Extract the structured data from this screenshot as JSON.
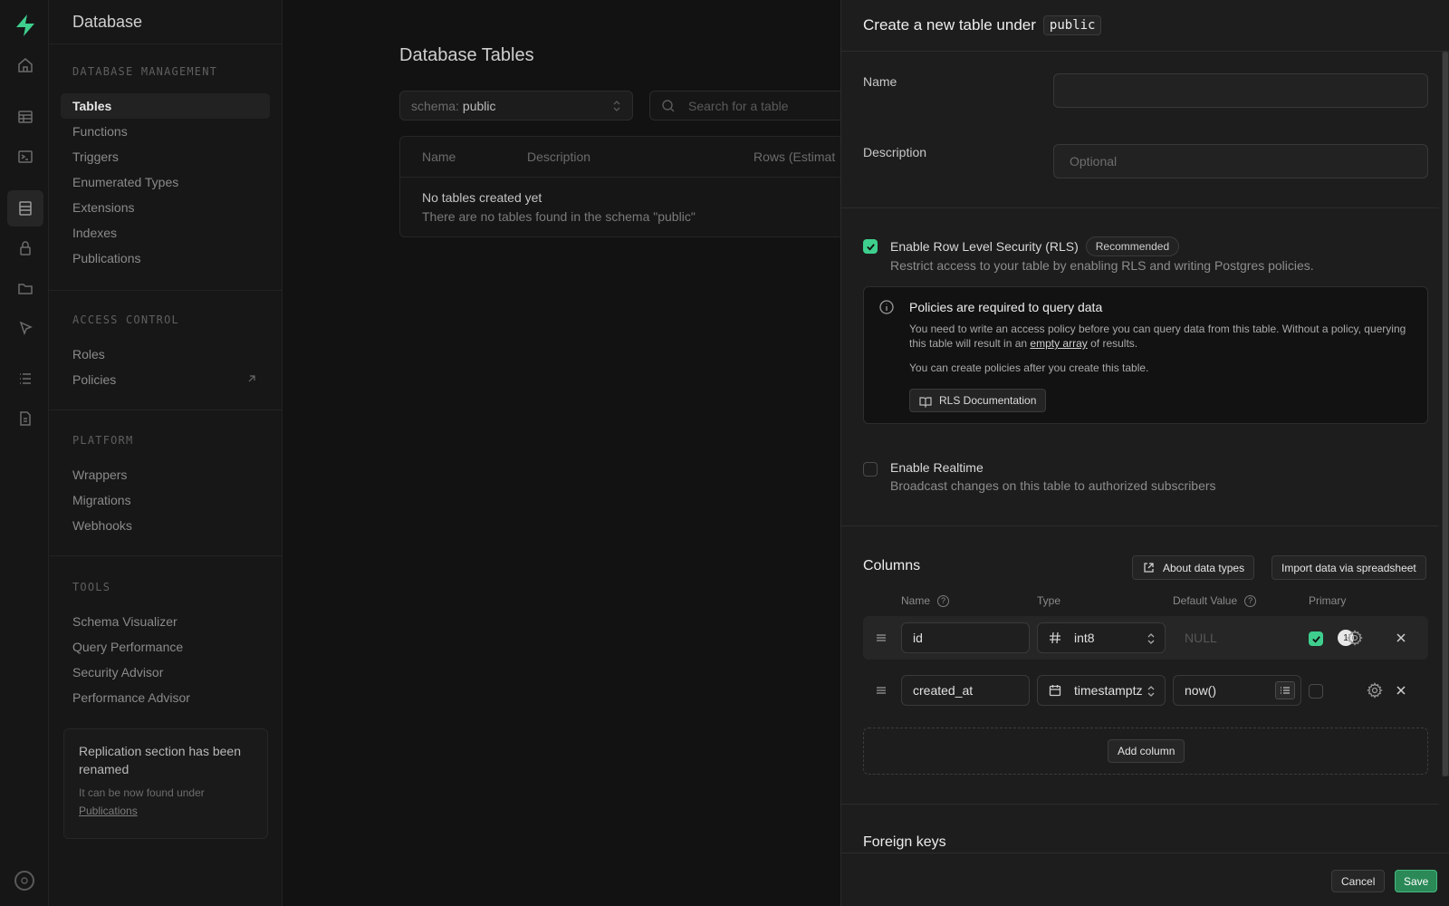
{
  "colors": {
    "accent": "#3ecf8e",
    "save_button": "#2a8957",
    "panel_bg": "#1d1d1d"
  },
  "rail": {
    "logo": "supabase-logo",
    "icons": [
      "home-icon",
      "table-editor-icon",
      "sql-editor-icon",
      "database-icon",
      "auth-lock-icon",
      "storage-icon",
      "edge-functions-icon",
      "logs-icon",
      "reports-icon"
    ],
    "active": "database-icon"
  },
  "sidebar": {
    "title": "Database",
    "sections": [
      {
        "title": "DATABASE MANAGEMENT",
        "items": [
          "Tables",
          "Functions",
          "Triggers",
          "Enumerated Types",
          "Extensions",
          "Indexes",
          "Publications"
        ]
      },
      {
        "title": "ACCESS CONTROL",
        "items": [
          "Roles",
          "Policies"
        ]
      },
      {
        "title": "PLATFORM",
        "items": [
          "Wrappers",
          "Migrations",
          "Webhooks"
        ]
      },
      {
        "title": "TOOLS",
        "items": [
          "Schema Visualizer",
          "Query Performance",
          "Security Advisor",
          "Performance Advisor"
        ]
      }
    ],
    "active_item": "Tables",
    "notice": {
      "title": "Replication section has been renamed",
      "body": "It can be now found under",
      "link": "Publications"
    }
  },
  "main": {
    "title": "Database Tables",
    "schema_label": "schema:",
    "schema_value": "public",
    "search_placeholder": "Search for a table",
    "columns": [
      "Name",
      "Description",
      "Rows (Estimat"
    ],
    "empty_title": "No tables created yet",
    "empty_sub": "There are no tables found in the schema \"public\""
  },
  "panel": {
    "header_prefix": "Create a new table under",
    "schema": "public",
    "name_label": "Name",
    "name_value": "",
    "description_label": "Description",
    "description_placeholder": "Optional",
    "rls": {
      "checked": true,
      "title": "Enable Row Level Security (RLS)",
      "badge": "Recommended",
      "desc": "Restrict access to your table by enabling RLS and writing Postgres policies."
    },
    "alert": {
      "title": "Policies are required to query data",
      "body_1": "You need to write an access policy before you can query data from this table. Without a policy, querying this table will result in an",
      "body_link": "empty array",
      "body_2": "of results.",
      "body_3": "You can create policies after you create this table.",
      "button": "RLS Documentation"
    },
    "realtime": {
      "checked": false,
      "title": "Enable Realtime",
      "desc": "Broadcast changes on this table to authorized subscribers"
    },
    "columns": {
      "title": "Columns",
      "about_button": "About data types",
      "import_button": "Import data via spreadsheet",
      "headers": {
        "name": "Name",
        "type": "Type",
        "default": "Default Value",
        "primary": "Primary"
      },
      "rows": [
        {
          "name": "id",
          "type": "int8",
          "type_icon": "hash-icon",
          "default": "NULL",
          "primary": true,
          "badge": "1"
        },
        {
          "name": "created_at",
          "type": "timestamptz",
          "type_icon": "calendar-icon",
          "default": "now()",
          "primary": false
        }
      ],
      "add_button": "Add column"
    },
    "foreign_keys_title": "Foreign keys",
    "cancel": "Cancel",
    "save": "Save"
  }
}
